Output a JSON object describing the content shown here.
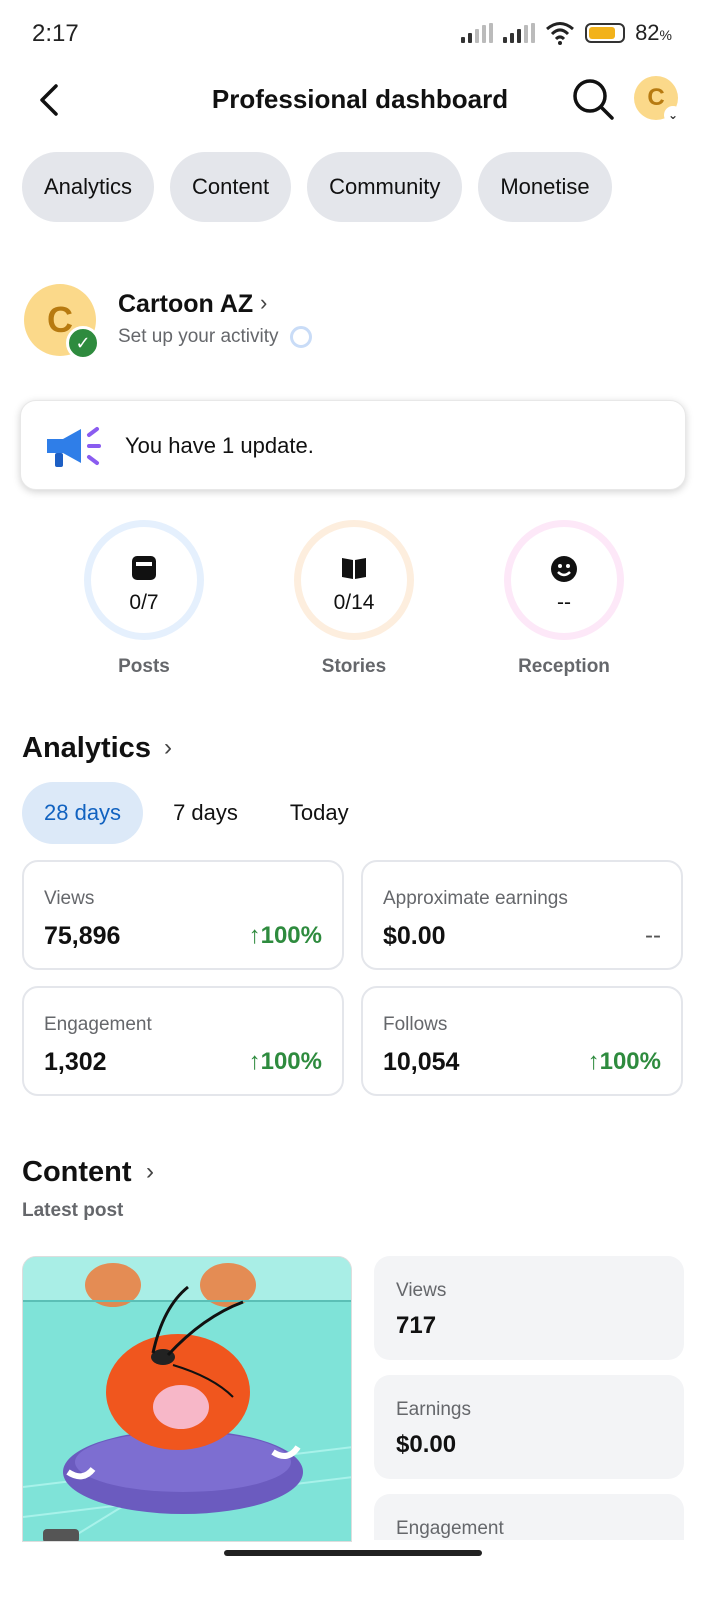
{
  "status_bar": {
    "time": "2:17",
    "battery": "82",
    "battery_unit": "%",
    "battery_level": 0.82
  },
  "header": {
    "title": "Professional dashboard",
    "avatar_initial": "C"
  },
  "tabs": [
    {
      "label": "Analytics"
    },
    {
      "label": "Content"
    },
    {
      "label": "Community"
    },
    {
      "label": "Monetise"
    }
  ],
  "profile": {
    "name": "Cartoon AZ",
    "initial": "C",
    "subtitle": "Set up your activity"
  },
  "update": {
    "text": "You have 1 update."
  },
  "stats": [
    {
      "value": "0/7",
      "label": "Posts",
      "icon": "post-icon"
    },
    {
      "value": "0/14",
      "label": "Stories",
      "icon": "book-icon"
    },
    {
      "value": "--",
      "label": "Reception",
      "icon": "smile-icon"
    }
  ],
  "analytics": {
    "title": "Analytics",
    "ranges": [
      {
        "label": "28 days"
      },
      {
        "label": "7 days"
      },
      {
        "label": "Today"
      }
    ],
    "metrics": [
      {
        "label": "Views",
        "value": "75,896",
        "delta": "100%",
        "arrow": "↑"
      },
      {
        "label": "Approximate earnings",
        "value": "$0.00",
        "delta": "--"
      },
      {
        "label": "Engagement",
        "value": "1,302",
        "delta": "100%",
        "arrow": "↑"
      },
      {
        "label": "Follows",
        "value": "10,054",
        "delta": "100%",
        "arrow": "↑"
      }
    ]
  },
  "content": {
    "title": "Content",
    "subtitle": "Latest post",
    "post_stats": [
      {
        "label": "Views",
        "value": "717"
      },
      {
        "label": "Earnings",
        "value": "$0.00"
      },
      {
        "label": "Engagement"
      }
    ]
  },
  "colors": {
    "accent": "#1162c0",
    "positive": "#2e8b3e",
    "chip_bg": "#e4e6eb"
  }
}
